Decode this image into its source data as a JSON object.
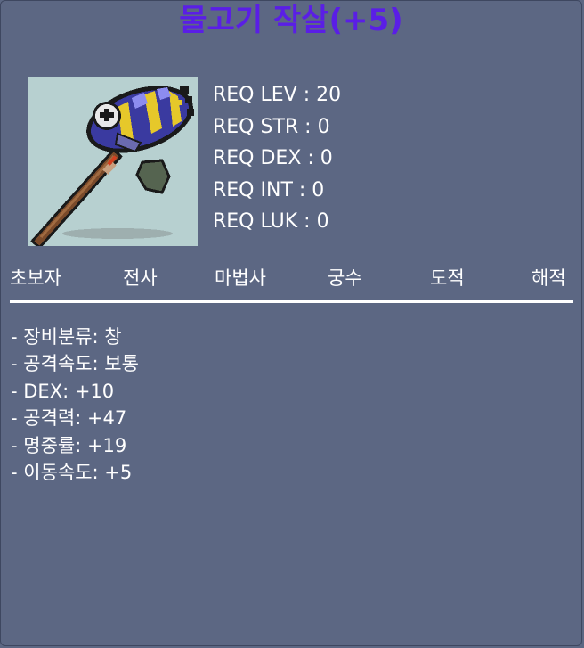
{
  "item": {
    "name": "물고기 작살(+5)",
    "icon": "fish-harpoon-icon",
    "name_color": "#5a1ee6"
  },
  "requirements": [
    "REQ LEV : 20",
    "REQ STR : 0",
    "REQ DEX : 0",
    "REQ INT : 0",
    "REQ LUK : 0"
  ],
  "jobs": [
    "초보자",
    "전사",
    "마법사",
    "궁수",
    "도적",
    "해적"
  ],
  "stats": [
    "- 장비분류: 창",
    "- 공격속도: 보통",
    "- DEX: +10",
    "- 공격력: +47",
    "- 명중률: +19",
    "- 이동속도: +5"
  ],
  "colors": {
    "background": "#5c6783",
    "text": "#ffffff",
    "icon_background": "#b7d0d0"
  }
}
